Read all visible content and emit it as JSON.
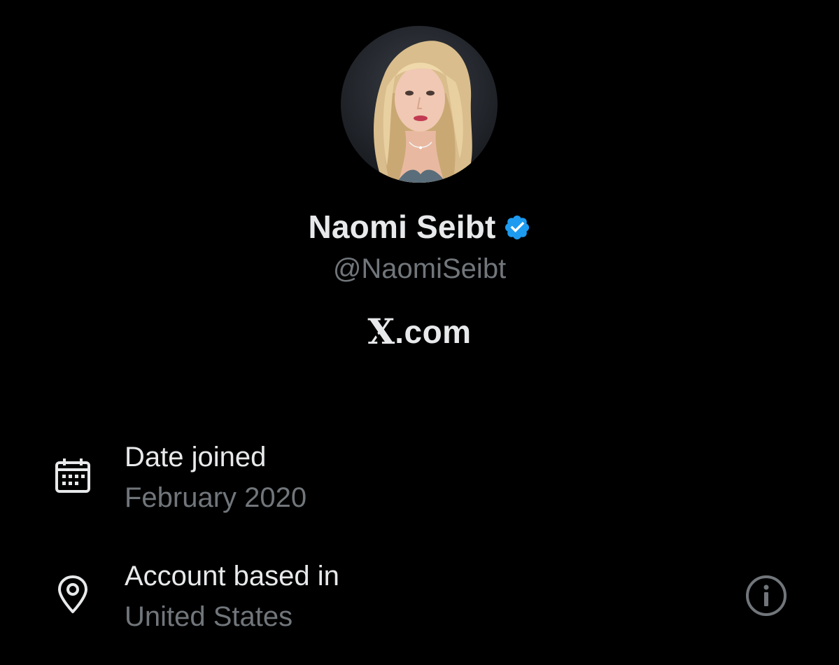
{
  "profile": {
    "display_name": "Naomi Seibt",
    "handle": "@NaomiSeibt",
    "verified": true,
    "avatar_icon": "profile-photo"
  },
  "site": {
    "logo_glyph": "X",
    "text": ".com"
  },
  "about": {
    "date_joined": {
      "icon": "calendar-icon",
      "title": "Date joined",
      "value": "February 2020"
    },
    "account_based_in": {
      "icon": "location-pin-icon",
      "title": "Account based in",
      "value": "United States",
      "action_icon": "info-icon"
    }
  },
  "colors": {
    "background": "#000000",
    "primary_text": "#e7e9ea",
    "secondary_text": "#71767b",
    "verified_blue": "#1d9bf0"
  }
}
